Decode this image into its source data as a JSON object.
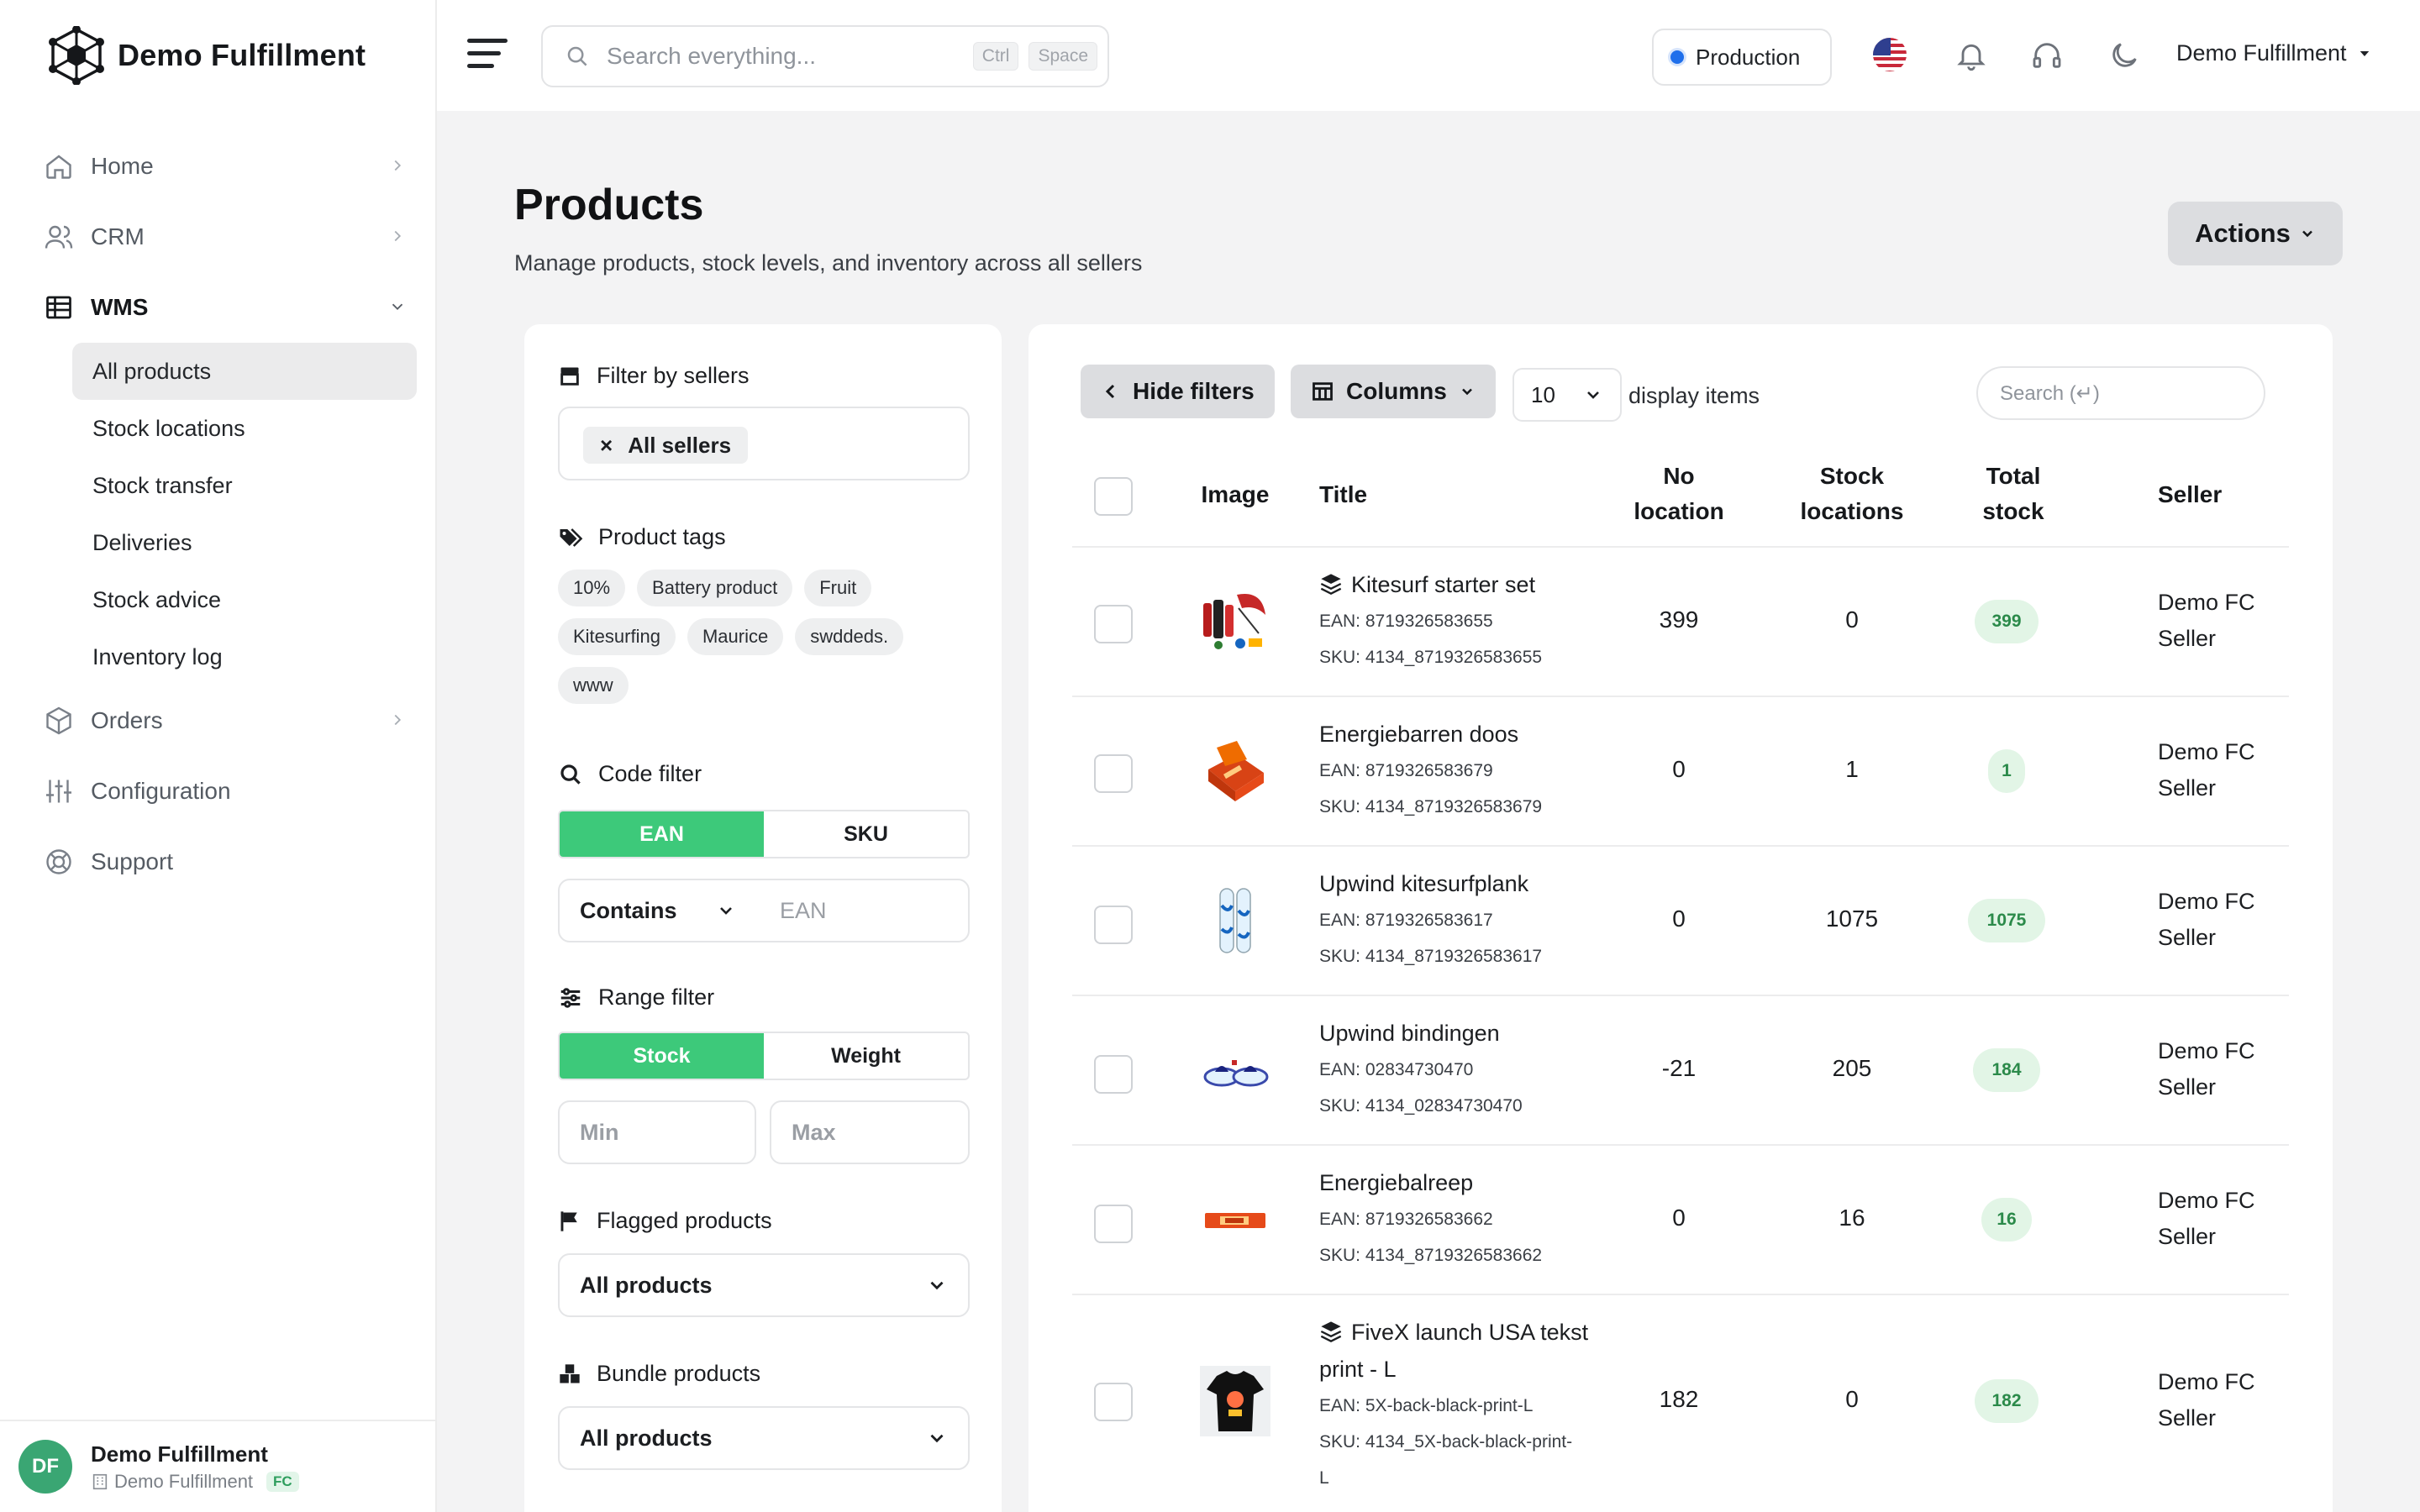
{
  "brand": {
    "name": "Demo Fulfillment"
  },
  "sidebar": {
    "items": [
      {
        "label": "Home"
      },
      {
        "label": "CRM"
      },
      {
        "label": "WMS"
      },
      {
        "label": "Orders"
      },
      {
        "label": "Configuration"
      },
      {
        "label": "Support"
      }
    ],
    "wms_sub": [
      {
        "label": "All products"
      },
      {
        "label": "Stock locations"
      },
      {
        "label": "Stock transfer"
      },
      {
        "label": "Deliveries"
      },
      {
        "label": "Stock advice"
      },
      {
        "label": "Inventory log"
      }
    ],
    "footer": {
      "initials": "DF",
      "name": "Demo Fulfillment",
      "org": "Demo Fulfillment",
      "badge": "FC"
    }
  },
  "topbar": {
    "search_placeholder": "Search everything...",
    "kbd1": "Ctrl",
    "kbd2": "Space",
    "environment": "Production",
    "user": "Demo Fulfillment"
  },
  "page": {
    "title": "Products",
    "subtitle": "Manage products, stock levels, and inventory across all sellers",
    "actions_label": "Actions"
  },
  "filters": {
    "sellers_title": "Filter by sellers",
    "sellers_chip": "All sellers",
    "tags_title": "Product tags",
    "tags": [
      "10%",
      "Battery product",
      "Fruit",
      "Kitesurfing",
      "Maurice",
      "swddeds.",
      "www"
    ],
    "code_title": "Code filter",
    "code_options": [
      "EAN",
      "SKU"
    ],
    "code_match": "Contains",
    "code_placeholder": "EAN",
    "range_title": "Range filter",
    "range_options": [
      "Stock",
      "Weight"
    ],
    "min_placeholder": "Min",
    "max_placeholder": "Max",
    "flagged_title": "Flagged products",
    "flagged_value": "All products",
    "bundle_title": "Bundle products",
    "bundle_value": "All products"
  },
  "table": {
    "hide_filters": "Hide filters",
    "columns": "Columns",
    "per_page": "10",
    "display_items": "display items",
    "search_placeholder": "Search (↵)",
    "headers": {
      "image": "Image",
      "title": "Title",
      "no_location_1": "No",
      "no_location_2": "location",
      "stock_locations_1": "Stock",
      "stock_locations_2": "locations",
      "total_stock_1": "Total",
      "total_stock_2": "stock",
      "seller": "Seller"
    },
    "rows": [
      {
        "title": "Kitesurf starter set",
        "bundle": true,
        "ean": "EAN: 8719326583655",
        "sku": "SKU: 4134_8719326583655",
        "no_location": "399",
        "stock_locations": "0",
        "total_stock": "399",
        "seller_1": "Demo FC",
        "seller_2": "Seller"
      },
      {
        "title": "Energiebarren doos",
        "bundle": false,
        "ean": "EAN: 8719326583679",
        "sku": "SKU: 4134_8719326583679",
        "no_location": "0",
        "stock_locations": "1",
        "total_stock": "1",
        "seller_1": "Demo FC",
        "seller_2": "Seller"
      },
      {
        "title": "Upwind kitesurfplank",
        "bundle": false,
        "ean": "EAN: 8719326583617",
        "sku": "SKU: 4134_8719326583617",
        "no_location": "0",
        "stock_locations": "1075",
        "total_stock": "1075",
        "seller_1": "Demo FC",
        "seller_2": "Seller"
      },
      {
        "title": "Upwind bindingen",
        "bundle": false,
        "ean": "EAN: 02834730470",
        "sku": "SKU: 4134_02834730470",
        "no_location": "-21",
        "stock_locations": "205",
        "total_stock": "184",
        "seller_1": "Demo FC",
        "seller_2": "Seller"
      },
      {
        "title": "Energiebalreep",
        "bundle": false,
        "ean": "EAN: 8719326583662",
        "sku": "SKU: 4134_8719326583662",
        "no_location": "0",
        "stock_locations": "16",
        "total_stock": "16",
        "seller_1": "Demo FC",
        "seller_2": "Seller"
      },
      {
        "title_1": "FiveX launch USA tekst",
        "title_2": "print - L",
        "bundle": true,
        "ean": "EAN: 5X-back-black-print-L",
        "sku_1": "SKU: 4134_5X-back-black-print-",
        "sku_2": "L",
        "no_location": "182",
        "stock_locations": "0",
        "total_stock": "182",
        "seller_1": "Demo FC",
        "seller_2": "Seller"
      }
    ]
  },
  "colors": {
    "accent_green": "#3dc97a",
    "badge_green_bg": "#e2f5e6",
    "badge_green_text": "#2b8a4a",
    "env_dot": "#1f6feb"
  }
}
